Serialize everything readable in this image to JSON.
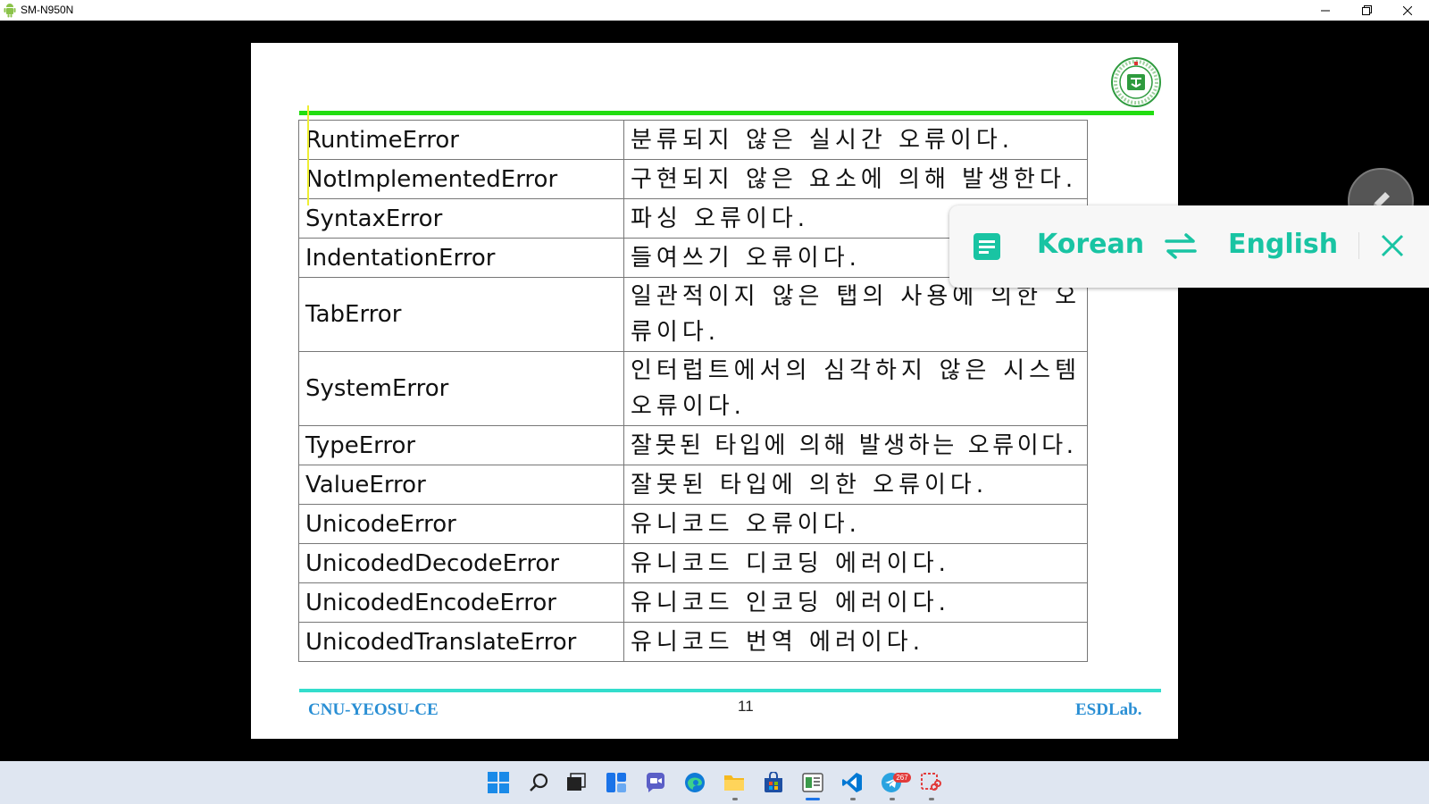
{
  "window": {
    "title": "SM-N950N"
  },
  "slide": {
    "rows": [
      {
        "name": "RuntimeError",
        "desc": "분류되지 않은 실시간 오류이다."
      },
      {
        "name": "NotImplementedError",
        "desc": "구현되지 않은 요소에 의해 발생한다."
      },
      {
        "name": "SyntaxError",
        "desc": "파싱 오류이다."
      },
      {
        "name": "IndentationError",
        "desc": "들여쓰기 오류이다."
      },
      {
        "name": "TabError",
        "desc": "일관적이지 않은 탭의 사용에 의한 오류이다."
      },
      {
        "name": "SystemError",
        "desc": "인터럽트에서의 심각하지 않은 시스템 오류이다."
      },
      {
        "name": "TypeError",
        "desc": "잘못된 타입에 의해 발생하는 오류이다."
      },
      {
        "name": "ValueError",
        "desc": "잘못된 타입에 의한 오류이다."
      },
      {
        "name": "UnicodeError",
        "desc": "유니코드 오류이다."
      },
      {
        "name": "UnicodedDecodeError",
        "desc": "유니코드 디코딩 에러이다."
      },
      {
        "name": "UnicodedEncodeError",
        "desc": "유니코드 인코딩 에러이다."
      },
      {
        "name": "UnicodedTranslateError",
        "desc": "유니코드 번역 에러이다."
      }
    ],
    "footer": {
      "left": "CNU-YEOSU-CE",
      "page": "11",
      "right": "ESDLab."
    }
  },
  "translator": {
    "source_lang": "Korean",
    "target_lang": "English"
  },
  "taskbar": {
    "telegram_badge": "267"
  },
  "icons": {
    "window": [
      "android-icon",
      "minimize-icon",
      "restore-icon",
      "close-icon"
    ],
    "overlay": [
      "pencil-icon",
      "document-icon",
      "swap-icon",
      "close-icon"
    ],
    "taskbar": [
      "start-icon",
      "search-icon",
      "task-view-icon",
      "widgets-icon",
      "chat-icon",
      "edge-icon",
      "file-explorer-icon",
      "store-icon",
      "phone-mirror-icon",
      "vscode-icon",
      "telegram-icon",
      "snipping-tool-icon"
    ]
  },
  "colors": {
    "accent_teal": "#19c4a3",
    "slide_green": "#22dd11",
    "footer_blue": "#2a8fd4"
  }
}
